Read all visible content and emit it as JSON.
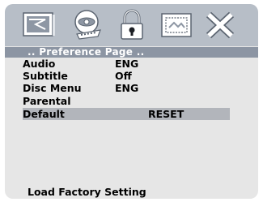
{
  "toolbar": {
    "icons": [
      "tv-screen-icon",
      "disc-audio-icon",
      "lock-icon",
      "picture-frame-icon",
      "close-x-icon"
    ]
  },
  "header": {
    "title": ".. Preference  Page .."
  },
  "menu": {
    "items": [
      {
        "label": "Audio",
        "value": "ENG"
      },
      {
        "label": "Subtitle",
        "value": "Off"
      },
      {
        "label": "Disc  Menu",
        "value": "ENG"
      },
      {
        "label": "Parental",
        "value": ""
      },
      {
        "label": "Default",
        "value": "RESET"
      }
    ]
  },
  "footer": {
    "hint": "Load  Factory  Setting"
  },
  "colors": {
    "topbar": "#b7bec7",
    "header": "#8c95a3",
    "panel": "#e6e6e6",
    "selected": "#b2b5bb"
  }
}
